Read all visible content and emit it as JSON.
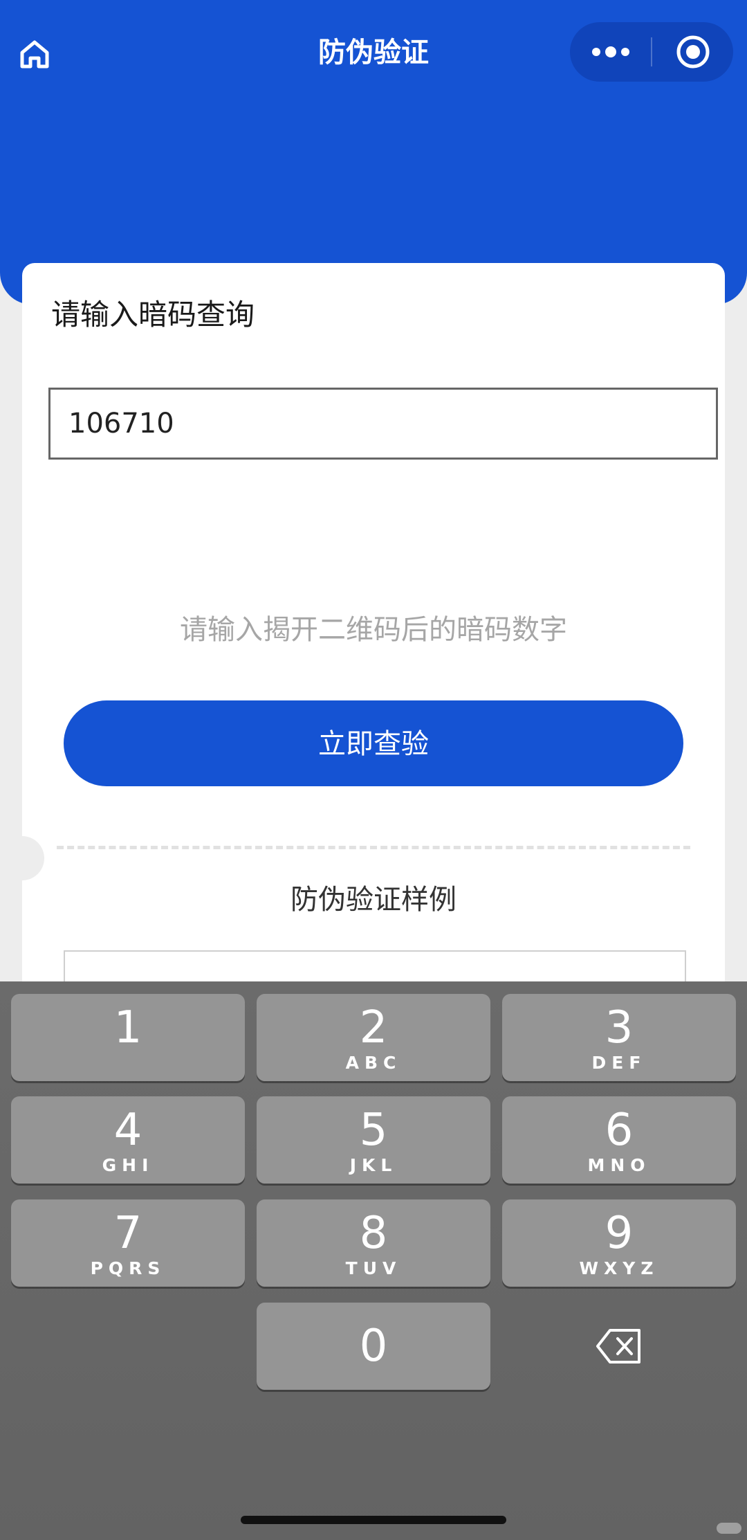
{
  "navbar": {
    "title": "防伪验证",
    "home_icon": "home-icon",
    "more_icon": "more-dots-icon",
    "close_icon": "target-close-icon"
  },
  "query": {
    "heading": "请输入暗码查询",
    "input_value": "106710",
    "hint": "请输入揭开二维码后的暗码数字",
    "button_label": "立即查验"
  },
  "sample": {
    "heading": "防伪验证样例"
  },
  "keypad": {
    "keys": [
      {
        "digit": "1",
        "letters": ""
      },
      {
        "digit": "2",
        "letters": "ABC"
      },
      {
        "digit": "3",
        "letters": "DEF"
      },
      {
        "digit": "4",
        "letters": "GHI"
      },
      {
        "digit": "5",
        "letters": "JKL"
      },
      {
        "digit": "6",
        "letters": "MNO"
      },
      {
        "digit": "7",
        "letters": "PQRS"
      },
      {
        "digit": "8",
        "letters": "TUV"
      },
      {
        "digit": "9",
        "letters": "WXYZ"
      },
      {
        "digit": "0",
        "letters": ""
      }
    ],
    "delete_icon": "backspace-icon"
  },
  "colors": {
    "primary": "#1553d3",
    "keyboard_bg": "#666666",
    "key_bg": "#959595"
  }
}
